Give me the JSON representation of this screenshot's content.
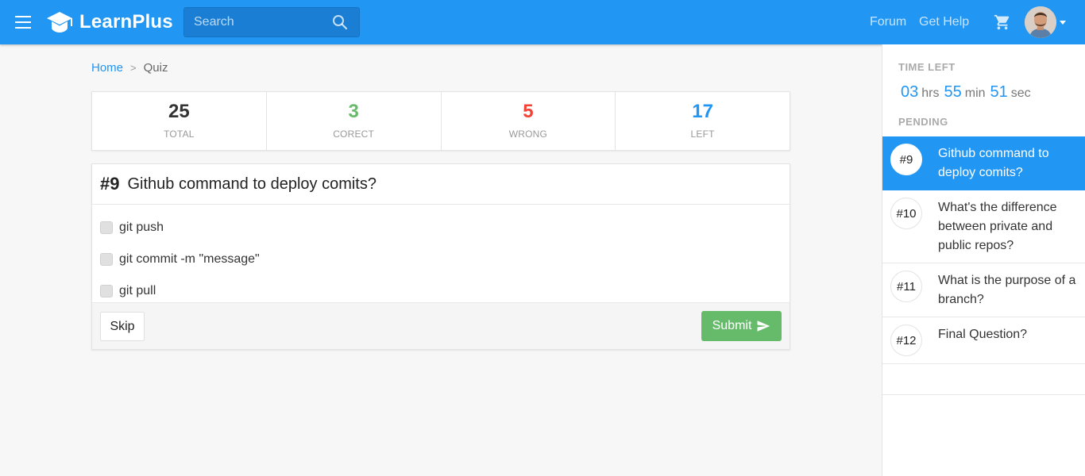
{
  "header": {
    "brand": "LearnPlus",
    "search_placeholder": "Search",
    "nav": [
      "Forum",
      "Get Help"
    ]
  },
  "breadcrumb": {
    "home": "Home",
    "separator": ">",
    "current": "Quiz"
  },
  "stats": [
    {
      "value": "25",
      "label": "TOTAL",
      "color": "#333333"
    },
    {
      "value": "3",
      "label": "CORECT",
      "color": "#66bb6a"
    },
    {
      "value": "5",
      "label": "WRONG",
      "color": "#f44336"
    },
    {
      "value": "17",
      "label": "LEFT",
      "color": "#2196f3"
    }
  ],
  "question": {
    "number": "#9",
    "text": "Github command to deploy comits?",
    "options": [
      "git push",
      "git commit -m \"message\"",
      "git pull"
    ],
    "skip_label": "Skip",
    "submit_label": "Submit"
  },
  "sidebar": {
    "time_left_title": "TIME LEFT",
    "timer": {
      "hours": "03",
      "hours_unit": "hrs",
      "minutes": "55",
      "minutes_unit": "min",
      "seconds": "51",
      "seconds_unit": "sec"
    },
    "pending_title": "PENDING",
    "pending": [
      {
        "number": "#9",
        "text": "Github command to deploy comits?",
        "active": true
      },
      {
        "number": "#10",
        "text": "What's the difference between private and public repos?",
        "active": false
      },
      {
        "number": "#11",
        "text": "What is the purpose of a branch?",
        "active": false
      },
      {
        "number": "#12",
        "text": "Final Question?",
        "active": false
      }
    ]
  },
  "colors": {
    "primary": "#2196f3",
    "success": "#66bb6a",
    "danger": "#f44336"
  }
}
